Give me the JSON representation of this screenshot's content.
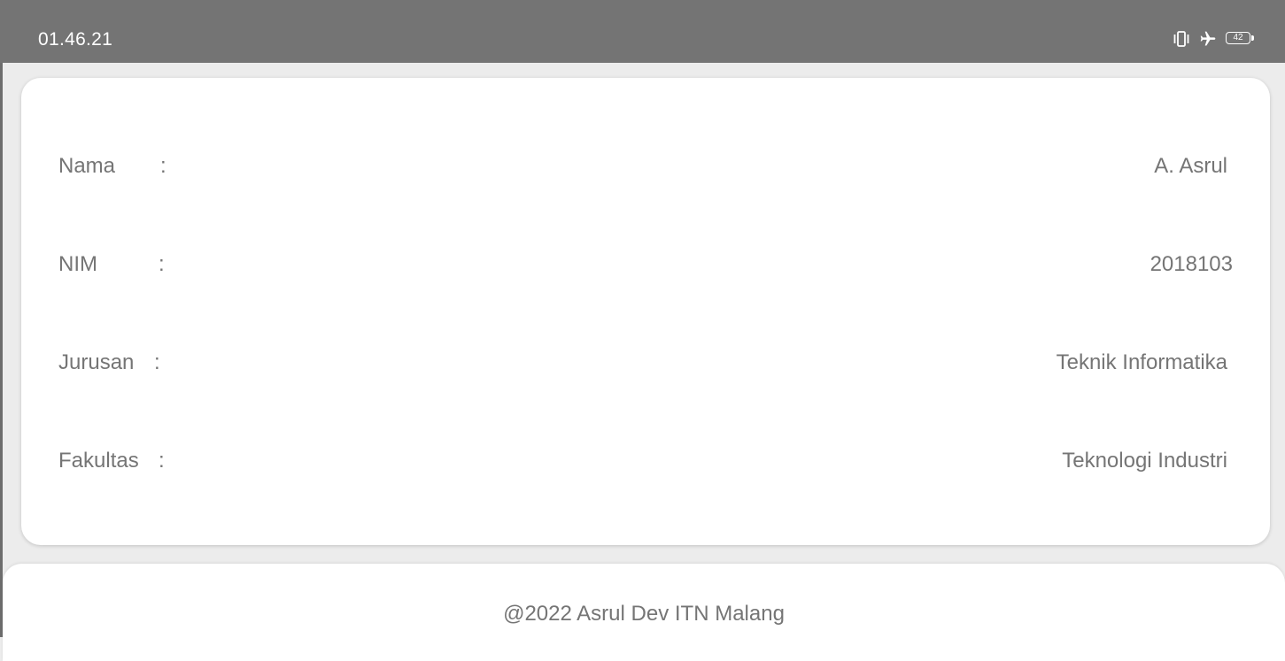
{
  "status_bar": {
    "time": "01.46.21",
    "icons": [
      "vibrate-icon",
      "airplane-mode-icon",
      "battery-icon"
    ],
    "battery_level": "42"
  },
  "info": {
    "rows": [
      {
        "label": "Nama",
        "colon": ":",
        "value": "A. Asrul"
      },
      {
        "label": "NIM",
        "colon": ":",
        "value": "2018103"
      },
      {
        "label": "Jurusan",
        "colon": ":",
        "value": "Teknik Informatika"
      },
      {
        "label": "Fakultas",
        "colon": ":",
        "value": "Teknologi Industri"
      }
    ]
  },
  "footer": {
    "text": "@2022 Asrul Dev ITN Malang"
  },
  "colors": {
    "status_bar_bg": "#747474",
    "page_bg": "#ececec",
    "card_bg": "#ffffff",
    "text": "#757575"
  }
}
